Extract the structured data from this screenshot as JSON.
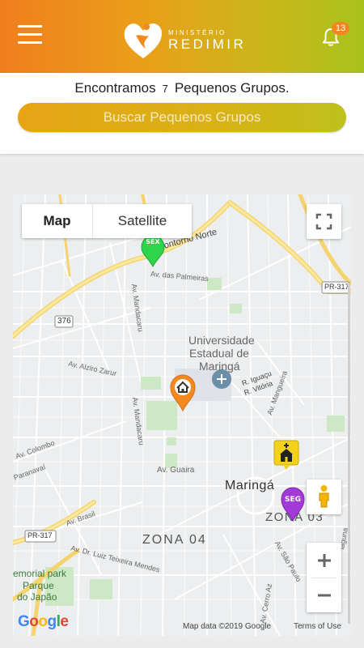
{
  "header": {
    "logo_small": "MINISTÉRIO",
    "logo_big": "REDIMIR",
    "notification_count": "13"
  },
  "results": {
    "prefix": "Encontramos",
    "count": "7",
    "suffix": "Pequenos Grupos.",
    "search_button": "Buscar Pequenos Grupos"
  },
  "map": {
    "type_map": "Map",
    "type_satellite": "Satellite",
    "attribution": "Map data ©2019 Google",
    "terms": "Terms of Use",
    "labels": {
      "contorno_norte": "Contorno Norte",
      "palmeiras": "Av. das Palmeiras",
      "pr317_top": "PR-317",
      "rd376": "376",
      "mandacaru_top": "Av. Mandacaru",
      "univ1": "Universidade",
      "univ2": "Estadual de",
      "univ3": "Maringá",
      "iguacu": "R. Iguaçu",
      "vitoria": "R. Vitória",
      "mangueira": "Av. Mangueira",
      "alziro": "Av. Alziro Zarur",
      "mandacaru_mid": "Av. Mandacaru",
      "colombo": "Av. Colombo",
      "paranavai": "Paranavaí",
      "guaira": "Av. Guaira",
      "maringa": "Maringá",
      "zona03": "ZONA 03",
      "brasil": "Av. Brasil",
      "pr317_bottom": "PR-317",
      "zona04": "ZONA 04",
      "teixeira": "Av. Dr. Luiz Teixeira Mendes",
      "memorial": "emorial park",
      "parque1": "Parque",
      "parque2": "do Japão",
      "saopaulo": "Av. São Paulo",
      "cerroaz": "Av. Cerro Az",
      "laguna": "laguna"
    },
    "markers": {
      "sex": "SEX",
      "seg": "SEG"
    }
  },
  "colors": {
    "header_start": "#f07e1e",
    "header_end": "#a8c21c",
    "marker_green": "#2ed44a",
    "marker_purple": "#a23ad8",
    "marker_orange": "#f5891f",
    "marker_yellow": "#f3d21b"
  },
  "icons": [
    "menu-icon",
    "bell-icon",
    "fullscreen-icon",
    "pegman-icon",
    "zoom-in-icon",
    "zoom-out-icon",
    "home-icon",
    "church-icon"
  ]
}
